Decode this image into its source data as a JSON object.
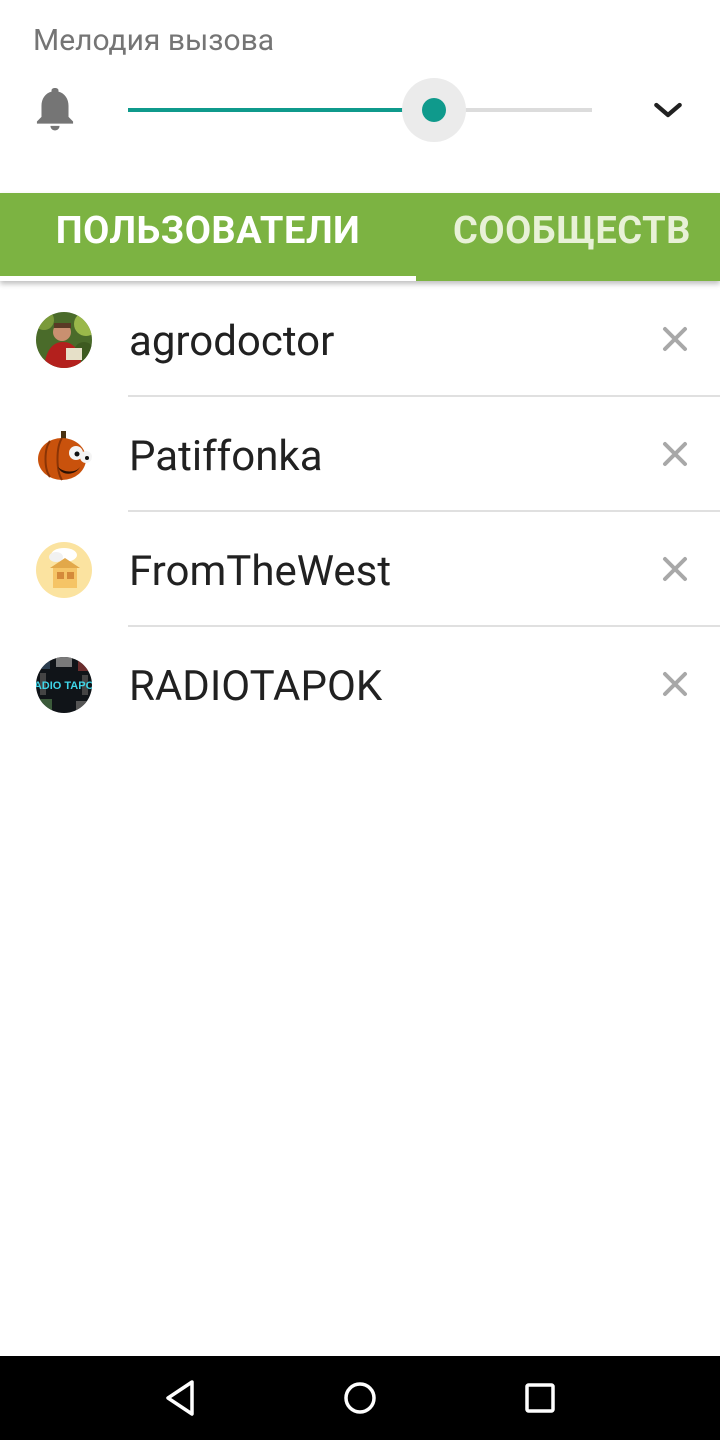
{
  "volume": {
    "title": "Мелодия вызова",
    "level": 0.66,
    "accent_color": "#0f9a8c",
    "icon": "bell-icon",
    "expand_icon": "chevron-down-icon"
  },
  "tabs": [
    {
      "label": "ПОЛЬЗОВАТЕЛИ",
      "selected": true
    },
    {
      "label": "СООБЩЕСТВ",
      "selected": false
    }
  ],
  "tab_bar_color": "#7cb342",
  "users": [
    {
      "name": "agrodoctor",
      "avatar": "avatar-agrodoctor",
      "remove_icon": "close-icon"
    },
    {
      "name": "Patiffonka",
      "avatar": "avatar-pumpkin",
      "remove_icon": "close-icon"
    },
    {
      "name": "FromTheWest",
      "avatar": "avatar-house",
      "remove_icon": "close-icon"
    },
    {
      "name": "RADIOTAPOK",
      "avatar": "avatar-radiotapok",
      "remove_icon": "close-icon"
    }
  ],
  "radiotapok_logo_text": "RADIO TAPOK",
  "navbar": {
    "buttons": [
      "back-icon",
      "home-icon",
      "recents-icon"
    ]
  }
}
